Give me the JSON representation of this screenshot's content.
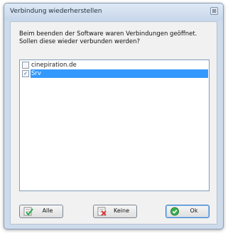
{
  "dialog": {
    "title": "Verbindung wiederherstellen",
    "close_glyph": "⊠",
    "message_line1": "Beim beenden der Software waren Verbindungen geöffnet.",
    "message_line2": "Sollen diese wieder verbunden werden?"
  },
  "connections": [
    {
      "label": "cinepiration.de",
      "checked": false,
      "selected": false
    },
    {
      "label": "Srv",
      "checked": true,
      "selected": true
    }
  ],
  "buttons": {
    "all": {
      "label": "Alle",
      "icon": "green-check-list-icon"
    },
    "none": {
      "label": "Keine",
      "icon": "red-uncheck-list-icon"
    },
    "ok": {
      "label": "Ok",
      "icon": "green-ok-circle-icon"
    }
  },
  "colors": {
    "selection": "#3399ff",
    "frame": "#cddbeb",
    "client": "#f1f1f1"
  }
}
